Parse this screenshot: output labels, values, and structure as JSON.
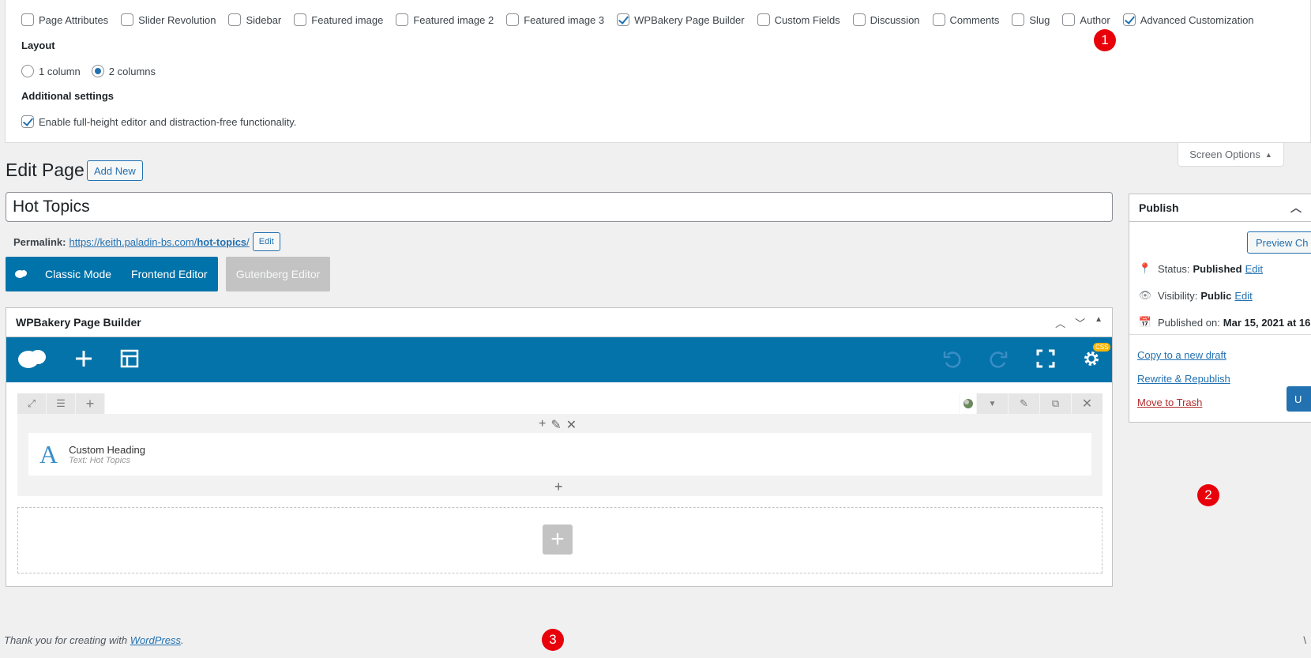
{
  "screen_options": {
    "boxes": [
      {
        "label": "Page Attributes",
        "checked": false
      },
      {
        "label": "Slider Revolution",
        "checked": false
      },
      {
        "label": "Sidebar",
        "checked": false
      },
      {
        "label": "Featured image",
        "checked": false
      },
      {
        "label": "Featured image 2",
        "checked": false
      },
      {
        "label": "Featured image 3",
        "checked": false
      },
      {
        "label": "WPBakery Page Builder",
        "checked": true
      },
      {
        "label": "Custom Fields",
        "checked": false
      },
      {
        "label": "Discussion",
        "checked": false
      },
      {
        "label": "Comments",
        "checked": false
      },
      {
        "label": "Slug",
        "checked": false
      },
      {
        "label": "Author",
        "checked": false
      },
      {
        "label": "Advanced Customization",
        "checked": true
      }
    ],
    "layout_label": "Layout",
    "layout_options": [
      {
        "label": "1 column",
        "checked": false
      },
      {
        "label": "2 columns",
        "checked": true
      }
    ],
    "additional_label": "Additional settings",
    "full_height_label": "Enable full-height editor and distraction-free functionality.",
    "full_height_checked": true,
    "tab_label": "Screen Options"
  },
  "markers": [
    "1",
    "2",
    "3"
  ],
  "header": {
    "title": "Edit Page",
    "add_new": "Add New"
  },
  "post": {
    "title": "Hot Topics",
    "permalink_label": "Permalink:",
    "permalink_base": "https://keith.paladin-bs.com/",
    "permalink_slug": "hot-topics",
    "permalink_trail": "/",
    "permalink_edit": "Edit"
  },
  "editor_switch": {
    "classic": "Classic Mode",
    "frontend": "Frontend Editor",
    "gutenberg": "Gutenberg Editor"
  },
  "wpbakery": {
    "title": "WPBakery Page Builder",
    "css_badge": "CSS",
    "element": {
      "name": "Custom Heading",
      "subtitle": "Text: Hot Topics"
    }
  },
  "publish": {
    "title": "Publish",
    "preview": "Preview Ch",
    "status_label": "Status:",
    "status_value": "Published",
    "visibility_label": "Visibility:",
    "visibility_value": "Public",
    "edit": "Edit",
    "published_label": "Published on:",
    "published_value": "Mar 15, 2021 at 16",
    "copy_draft": "Copy to a new draft",
    "rewrite": "Rewrite & Republish",
    "trash": "Move to Trash",
    "update": "U"
  },
  "footer": {
    "thanks_prefix": "Thank you for creating with",
    "thanks_link": "WordPress",
    "thanks_suffix": ".",
    "version": "\\"
  },
  "colors": {
    "accent": "#2271b1",
    "wpb_blue": "#0473aa",
    "marker_red": "#e8000a",
    "trash_red": "#b32d2e"
  }
}
